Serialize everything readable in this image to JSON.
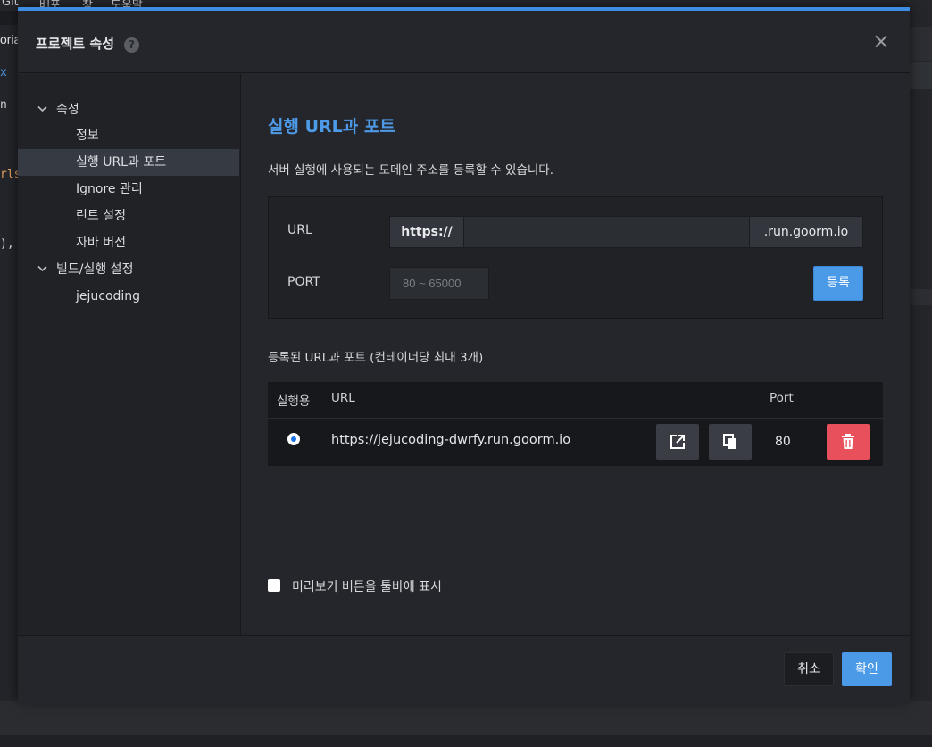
{
  "background": {
    "menu_items": [
      "Git",
      "배포",
      "창",
      "도움말"
    ],
    "left_fragments": [
      "oria",
      "x",
      "n",
      "rls",
      "),"
    ]
  },
  "dialog": {
    "title": "프로젝트 속성",
    "help": "?",
    "close": "×"
  },
  "sidebar": {
    "items": [
      {
        "label": "속성",
        "expanded": true
      },
      {
        "label": "정보"
      },
      {
        "label": "실행 URL과 포트",
        "active": true
      },
      {
        "label": "Ignore 관리"
      },
      {
        "label": "린트 설정"
      },
      {
        "label": "자바 버전"
      },
      {
        "label": "빌드/실행 설정",
        "expanded": true
      },
      {
        "label": "jejucoding"
      }
    ]
  },
  "main": {
    "title": "실행 URL과 포트",
    "description": "서버 실행에 사용되는 도메인 주소를 등록할 수 있습니다.",
    "form": {
      "url_label": "URL",
      "url_prefix": "https://",
      "url_value": "",
      "url_suffix": ".run.goorm.io",
      "port_label": "PORT",
      "port_placeholder": "80 ~ 65000",
      "register_label": "등록"
    },
    "list_title": "등록된 URL과 포트 (컨테이너당 최대 3개)",
    "table": {
      "headers": {
        "run": "실행용",
        "url": "URL",
        "port": "Port"
      },
      "rows": [
        {
          "url": "https://jejucoding-dwrfy.run.goorm.io",
          "port": "80",
          "selected": true
        }
      ]
    },
    "preview_toolbar_label": "미리보기 버튼을 툴바에 표시"
  },
  "footer": {
    "cancel_label": "취소",
    "ok_label": "확인"
  },
  "colors": {
    "accent": "#4b9ae8",
    "danger": "#e8505b",
    "title_blue": "#4d9be8"
  }
}
